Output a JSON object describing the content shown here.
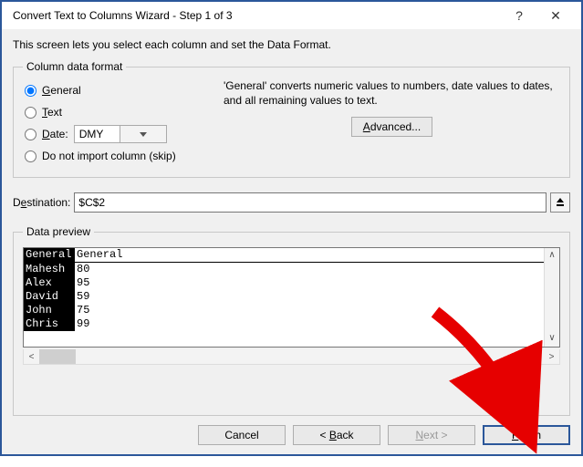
{
  "window": {
    "title": "Convert Text to Columns Wizard - Step 1 of 3",
    "help": "?",
    "close": "✕"
  },
  "intro": "This screen lets you select each column and set the Data Format.",
  "format_group": {
    "legend": "Column data format",
    "general": "General",
    "text": "Text",
    "date": "Date:",
    "date_fmt": "DMY",
    "skip": "Do not import column (skip)",
    "desc": "'General' converts numeric values to numbers, date values to dates, and all remaining values to text.",
    "advanced": "Advanced..."
  },
  "destination": {
    "label": "Destination:",
    "value": "$C$2"
  },
  "preview": {
    "legend": "Data preview",
    "header": {
      "a": "General",
      "b": "General"
    },
    "rows": [
      {
        "a": "Mahesh",
        "b": "80"
      },
      {
        "a": "Alex",
        "b": "95"
      },
      {
        "a": "David",
        "b": "59"
      },
      {
        "a": "John",
        "b": "75"
      },
      {
        "a": "Chris",
        "b": "99"
      }
    ]
  },
  "buttons": {
    "cancel": "Cancel",
    "back": "< Back",
    "next": "Next >",
    "finish": "Finish"
  }
}
